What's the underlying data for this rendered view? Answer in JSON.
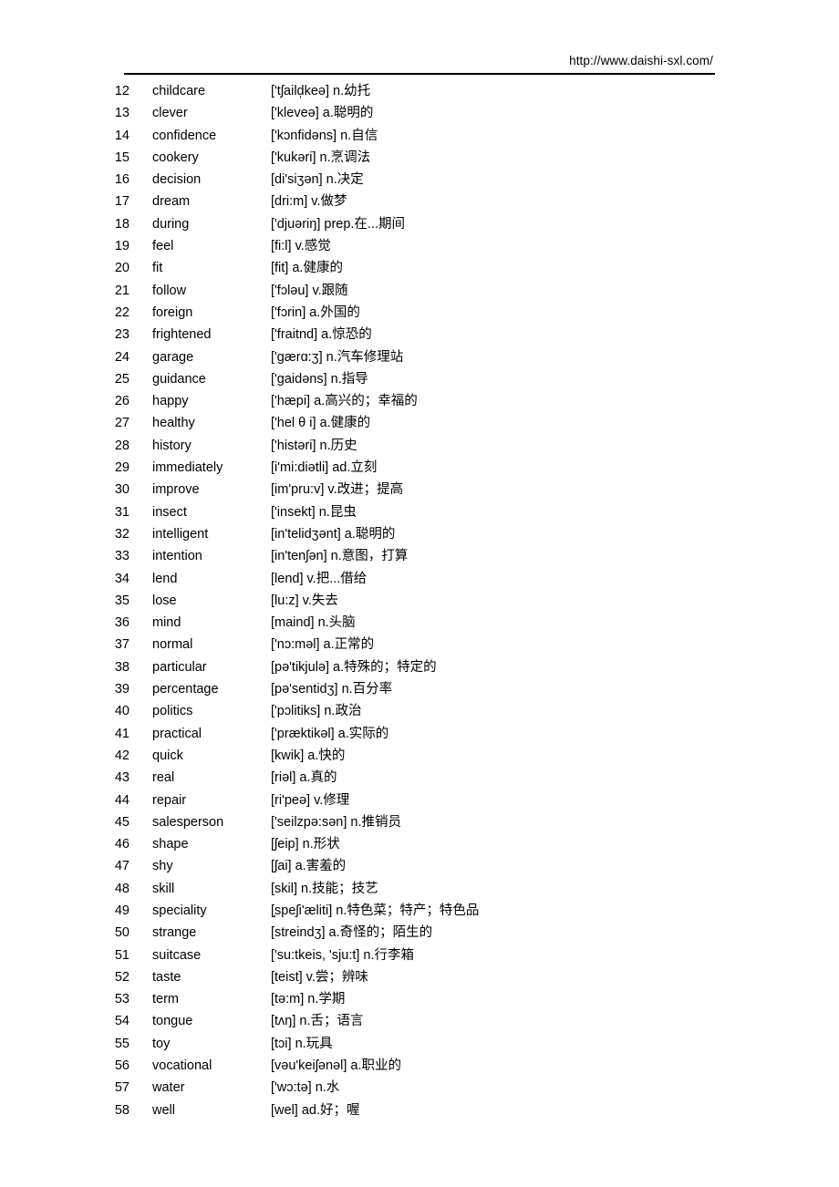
{
  "header": {
    "url": "http://www.daishi-sxl.com/"
  },
  "list": {
    "entries": [
      {
        "num": "12",
        "word": "childcare",
        "ipa": "['tʃald̥keə]",
        "def": "['tʃaild̩keə] n.幼托"
      },
      {
        "num": "13",
        "word": "clever",
        "def": "['kleveə] a.聪明的"
      },
      {
        "num": "14",
        "word": "confidence",
        "def": "['kɔnfidəns] n.自信"
      },
      {
        "num": "15",
        "word": "cookery",
        "def": "['kukəri] n.烹调法"
      },
      {
        "num": "16",
        "word": "decision",
        "def": "[di'siʒən] n.决定"
      },
      {
        "num": "17",
        "word": "dream",
        "def": "[dri:m] v.做梦"
      },
      {
        "num": "18",
        "word": "during",
        "def": "['djuəriŋ] prep.在...期间"
      },
      {
        "num": "19",
        "word": "feel",
        "def": "[fi:l] v.感觉"
      },
      {
        "num": "20",
        "word": "fit",
        "def": "[fit] a.健康的"
      },
      {
        "num": "21",
        "word": "follow",
        "def": "['fɔləu] v.跟随"
      },
      {
        "num": "22",
        "word": "foreign",
        "def": "['fɔrin] a.外国的"
      },
      {
        "num": "23",
        "word": "frightened",
        "def": "['fraitnd] a.惊恐的"
      },
      {
        "num": "24",
        "word": "garage",
        "def": "['gærɑ:ʒ] n.汽车修理站"
      },
      {
        "num": "25",
        "word": "guidance",
        "def": "['gaidəns] n.指导"
      },
      {
        "num": "26",
        "word": "happy",
        "def": "['hæpi] a.高兴的；幸福的"
      },
      {
        "num": "27",
        "word": "healthy",
        "def": "['hel θ i] a.健康的"
      },
      {
        "num": "28",
        "word": "history",
        "def": "['histəri] n.历史"
      },
      {
        "num": "29",
        "word": "immediately",
        "def": "[i'mi:diətli] ad.立刻"
      },
      {
        "num": "30",
        "word": "improve",
        "def": "[im'pru:v] v.改进；提高"
      },
      {
        "num": "31",
        "word": "insect",
        "def": "['insekt] n.昆虫"
      },
      {
        "num": "32",
        "word": "intelligent",
        "def": "[in'telidʒənt] a.聪明的"
      },
      {
        "num": "33",
        "word": "intention",
        "def": "[in'tenʃən] n.意图，打算"
      },
      {
        "num": "34",
        "word": "lend",
        "def": "[lend] v.把...借给"
      },
      {
        "num": "35",
        "word": "lose",
        "def": "[lu:z] v.失去"
      },
      {
        "num": "36",
        "word": "mind",
        "def": "[maind] n.头脑"
      },
      {
        "num": "37",
        "word": "normal",
        "def": "['nɔ:məl] a.正常的"
      },
      {
        "num": "38",
        "word": "particular",
        "def": "[pə'tikjulə] a.特殊的；特定的"
      },
      {
        "num": "39",
        "word": "percentage",
        "def": "[pə'sentidʒ] n.百分率"
      },
      {
        "num": "40",
        "word": "politics",
        "def": "['pɔlitiks] n.政治"
      },
      {
        "num": "41",
        "word": "practical",
        "def": "['præktikəl] a.实际的"
      },
      {
        "num": "42",
        "word": "quick",
        "def": "[kwik] a.快的"
      },
      {
        "num": "43",
        "word": "real",
        "def": "[riəl] a.真的"
      },
      {
        "num": "44",
        "word": "repair",
        "def": "[ri'peə] v.修理"
      },
      {
        "num": "45",
        "word": "salesperson",
        "def": "['seilzpə:sən] n.推销员"
      },
      {
        "num": "46",
        "word": "shape",
        "def": "[ʃeip] n.形状"
      },
      {
        "num": "47",
        "word": "shy",
        "def": "[ʃai] a.害羞的"
      },
      {
        "num": "48",
        "word": "skill",
        "def": "[skil] n.技能；技艺"
      },
      {
        "num": "49",
        "word": "speciality",
        "def": "[̦speʃi'æliti] n.特色菜；特产；特色品"
      },
      {
        "num": "50",
        "word": "strange",
        "def": "[streindʒ] a.奇怪的；陌生的"
      },
      {
        "num": "51",
        "word": "suitcase",
        "def": "['su:tkeis, 'sju:t] n.行李箱"
      },
      {
        "num": "52",
        "word": "taste",
        "def": "[teist] v.尝；辨味"
      },
      {
        "num": "53",
        "word": "term",
        "def": "[tə:m] n.学期"
      },
      {
        "num": "54",
        "word": "tongue",
        "def": "[tʌŋ] n.舌；语言"
      },
      {
        "num": "55",
        "word": "toy",
        "def": "[tɔi] n.玩具"
      },
      {
        "num": "56",
        "word": "vocational",
        "def": "[vəu'keiʃənəl] a.职业的"
      },
      {
        "num": "57",
        "word": "water",
        "def": "['wɔ:tə] n.水"
      },
      {
        "num": "58",
        "word": "well",
        "def": "[wel] ad.好；喔"
      }
    ]
  }
}
